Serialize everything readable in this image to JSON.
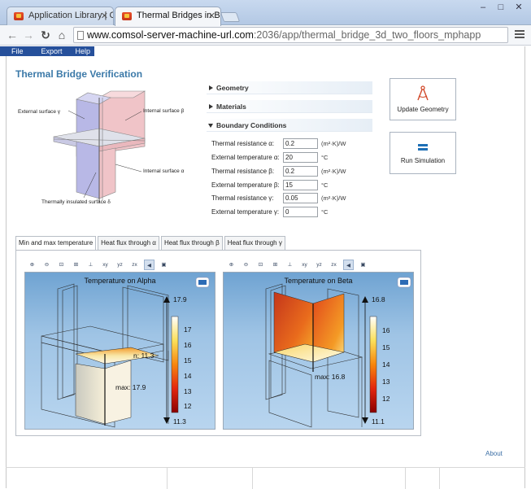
{
  "browser": {
    "tabs": [
      {
        "label": "Application Library | COM",
        "active": false
      },
      {
        "label": "Thermal Bridges in Buildin",
        "active": true
      }
    ],
    "url_host": "www.comsol-server-machine-url.com",
    "url_path": ":2036/app/thermal_bridge_3d_two_floors_mphapp",
    "window_buttons": [
      "–",
      "□",
      "✕"
    ]
  },
  "menu": {
    "items": [
      "File",
      "Export",
      "Help"
    ]
  },
  "app": {
    "title": "Thermal Bridge Verification",
    "diagram_labels": {
      "external_gamma": "External surface γ",
      "internal_beta": "Internal surface β",
      "internal_alpha": "Internal surface α",
      "insulated_delta": "Thermally insulated surface δ"
    },
    "sections": {
      "geometry": "Geometry",
      "materials": "Materials",
      "boundary": "Boundary Conditions"
    },
    "params": [
      {
        "label": "Thermal resistance α:",
        "value": "0.2",
        "unit": "(m²·K)/W"
      },
      {
        "label": "External temperature α:",
        "value": "20",
        "unit": "°C"
      },
      {
        "label": "Thermal resistance β:",
        "value": "0.2",
        "unit": "(m²·K)/W"
      },
      {
        "label": "External temperature β:",
        "value": "15",
        "unit": "°C"
      },
      {
        "label": "Thermal resistance γ:",
        "value": "0.05",
        "unit": "(m²·K)/W"
      },
      {
        "label": "External temperature γ:",
        "value": "0",
        "unit": "°C"
      }
    ],
    "buttons": {
      "update_geometry": "Update Geometry",
      "run_simulation": "Run Simulation"
    },
    "result_tabs": [
      {
        "label": "Min and max temperature",
        "active": true
      },
      {
        "label": "Heat flux through α",
        "active": false
      },
      {
        "label": "Heat flux through β",
        "active": false
      },
      {
        "label": "Heat flux through γ",
        "active": false
      }
    ],
    "graphics_toolbar": [
      "zoom-in-icon",
      "zoom-out-icon",
      "zoom-box-icon",
      "zoom-extents-icon",
      "axes-icon",
      "view-xy-icon",
      "view-yz-icon",
      "view-zx-icon",
      "sound-icon",
      "image-snapshot-icon"
    ],
    "plots": [
      {
        "title": "Temperature on Alpha",
        "max_label": "17.9",
        "min_label": "11.3",
        "ann_min": "n: 11.3",
        "ann_max": "max: 17.9",
        "ticks": [
          "17",
          "16",
          "15",
          "14",
          "13",
          "12"
        ]
      },
      {
        "title": "Temperature on Beta",
        "max_label": "16.8",
        "min_label": "11.1",
        "ann_min": "11.1",
        "ann_max": "max: 16.8",
        "ticks": [
          "16",
          "15",
          "14",
          "13",
          "12"
        ]
      }
    ],
    "about": "About"
  },
  "colors": {
    "accent_title": "#3b79a8",
    "menubar": "#26509b"
  }
}
